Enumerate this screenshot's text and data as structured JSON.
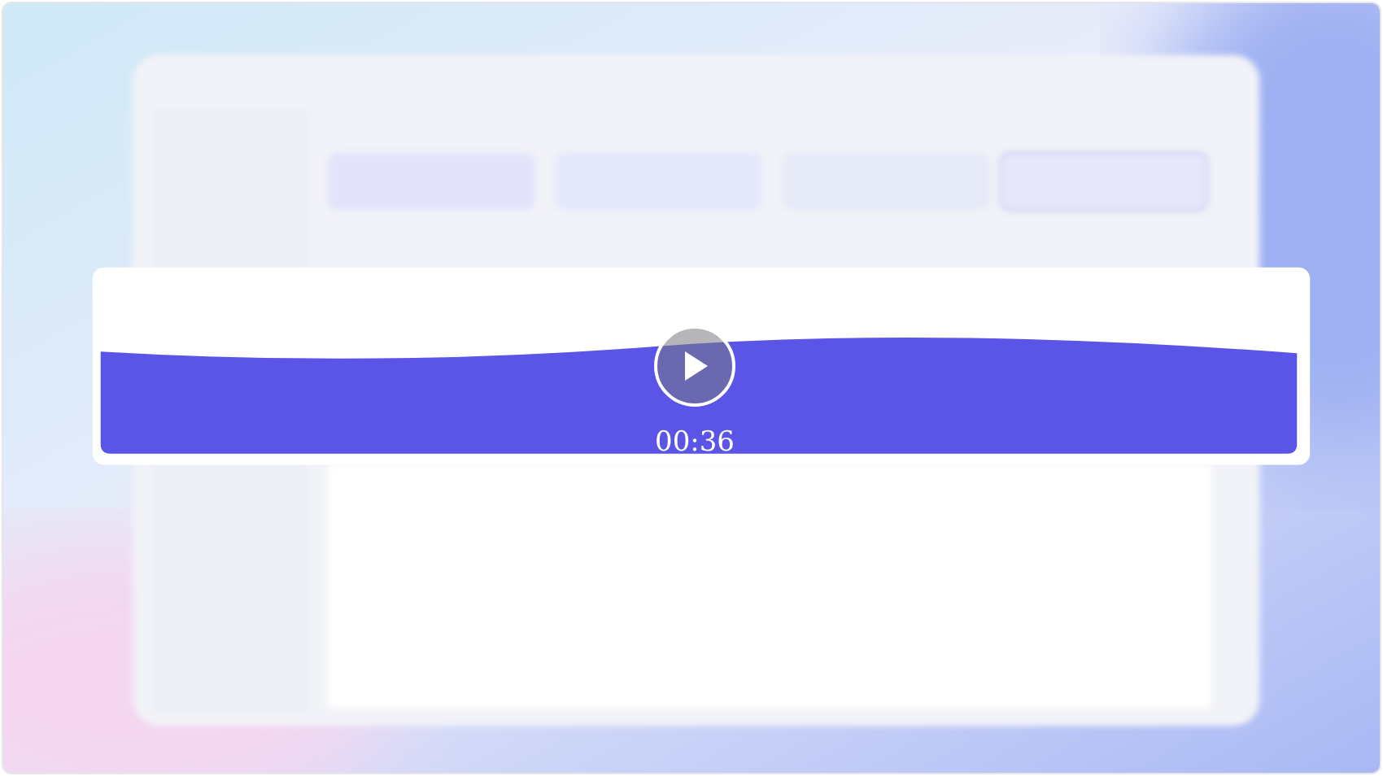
{
  "video": {
    "kind": "picture",
    "playing": false,
    "time": "00:36"
  }
}
